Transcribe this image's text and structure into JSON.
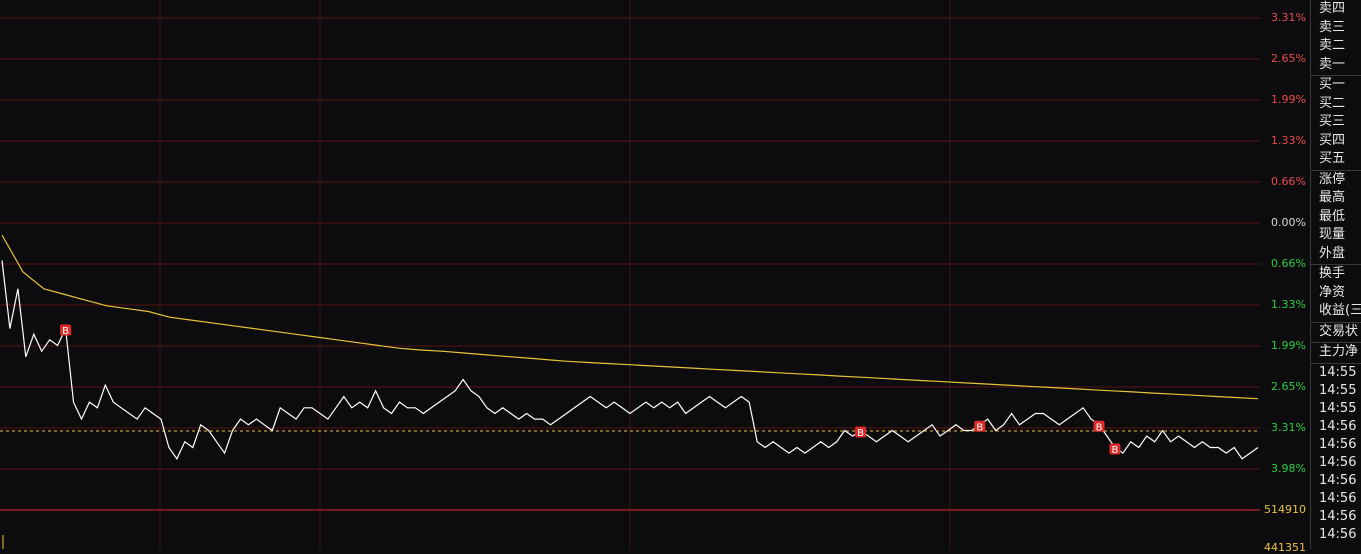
{
  "chart_data": {
    "type": "line",
    "pct_labels": [
      {
        "text": "3.31%",
        "color": "#e84a4a"
      },
      {
        "text": "2.65%",
        "color": "#e84a4a"
      },
      {
        "text": "1.99%",
        "color": "#e84a4a"
      },
      {
        "text": "1.33%",
        "color": "#e84a4a"
      },
      {
        "text": "0.66%",
        "color": "#e84a4a"
      },
      {
        "text": "0.00%",
        "color": "#d8d8d8"
      },
      {
        "text": "0.66%",
        "color": "#2ecc40"
      },
      {
        "text": "1.33%",
        "color": "#2ecc40"
      },
      {
        "text": "1.99%",
        "color": "#2ecc40"
      },
      {
        "text": "2.65%",
        "color": "#2ecc40"
      },
      {
        "text": "3.31%",
        "color": "#2ecc40"
      },
      {
        "text": "3.98%",
        "color": "#2ecc40"
      }
    ],
    "volume_labels": [
      "514910",
      "441351"
    ],
    "ylim": [
      -3.98,
      3.98
    ],
    "series": [
      {
        "color": "#ffffff",
        "values": [
          -0.3,
          -1.5,
          -0.8,
          -2.0,
          -1.6,
          -1.9,
          -1.7,
          -1.8,
          -1.5,
          -2.8,
          -3.1,
          -2.8,
          -2.9,
          -2.5,
          -2.8,
          -2.9,
          -3.0,
          -3.1,
          -2.9,
          -3.0,
          -3.1,
          -3.6,
          -3.8,
          -3.5,
          -3.6,
          -3.2,
          -3.3,
          -3.5,
          -3.7,
          -3.3,
          -3.1,
          -3.2,
          -3.1,
          -3.2,
          -3.3,
          -2.9,
          -3.0,
          -3.1,
          -2.9,
          -2.9,
          -3.0,
          -3.1,
          -2.9,
          -2.7,
          -2.9,
          -2.8,
          -2.9,
          -2.6,
          -2.9,
          -3.0,
          -2.8,
          -2.9,
          -2.9,
          -3.0,
          -2.9,
          -2.8,
          -2.7,
          -2.6,
          -2.4,
          -2.6,
          -2.7,
          -2.9,
          -3.0,
          -2.9,
          -3.0,
          -3.1,
          -3.0,
          -3.1,
          -3.1,
          -3.2,
          -3.1,
          -3.0,
          -2.9,
          -2.8,
          -2.7,
          -2.8,
          -2.9,
          -2.8,
          -2.9,
          -3.0,
          -2.9,
          -2.8,
          -2.9,
          -2.8,
          -2.9,
          -2.8,
          -3.0,
          -2.9,
          -2.8,
          -2.7,
          -2.8,
          -2.9,
          -2.8,
          -2.7,
          -2.8,
          -3.5,
          -3.6,
          -3.5,
          -3.6,
          -3.7,
          -3.6,
          -3.7,
          -3.6,
          -3.5,
          -3.6,
          -3.5,
          -3.3,
          -3.4,
          -3.3,
          -3.4,
          -3.5,
          -3.4,
          -3.3,
          -3.4,
          -3.5,
          -3.4,
          -3.3,
          -3.2,
          -3.4,
          -3.3,
          -3.2,
          -3.3,
          -3.3,
          -3.2,
          -3.1,
          -3.3,
          -3.2,
          -3.0,
          -3.2,
          -3.1,
          -3.0,
          -3.0,
          -3.1,
          -3.2,
          -3.1,
          -3.0,
          -2.9,
          -3.1,
          -3.2,
          -3.4,
          -3.6,
          -3.7,
          -3.5,
          -3.6,
          -3.4,
          -3.5,
          -3.3,
          -3.5,
          -3.4,
          -3.5,
          -3.6,
          -3.5,
          -3.6,
          -3.6,
          -3.7,
          -3.6,
          -3.8,
          -3.7,
          -3.6
        ],
        "markers": [
          {
            "index": 8,
            "label": "B",
            "color": "#e02a2a"
          },
          {
            "index": 108,
            "label": "B",
            "color": "#e02a2a"
          },
          {
            "index": 123,
            "label": "B",
            "color": "#e02a2a"
          },
          {
            "index": 138,
            "label": "B",
            "color": "#e02a2a"
          },
          {
            "index": 140,
            "label": "B",
            "color": "#e02a2a"
          }
        ]
      },
      {
        "color": "#e8c33a",
        "values": [
          0.15,
          -0.5,
          -0.8,
          -0.9,
          -1.0,
          -1.1,
          -1.15,
          -1.2,
          -1.3,
          -1.35,
          -1.4,
          -1.45,
          -1.5,
          -1.55,
          -1.6,
          -1.65,
          -1.7,
          -1.75,
          -1.8,
          -1.85,
          -1.88,
          -1.9,
          -1.93,
          -1.96,
          -1.99,
          -2.02,
          -2.05,
          -2.08,
          -2.1,
          -2.12,
          -2.14,
          -2.16,
          -2.18,
          -2.2,
          -2.22,
          -2.24,
          -2.26,
          -2.28,
          -2.3,
          -2.32,
          -2.34,
          -2.36,
          -2.38,
          -2.4,
          -2.42,
          -2.44,
          -2.46,
          -2.48,
          -2.5,
          -2.52,
          -2.54,
          -2.56,
          -2.58,
          -2.6,
          -2.62,
          -2.64,
          -2.66,
          -2.68,
          -2.7,
          -2.72,
          -2.74
        ]
      }
    ],
    "reference_pct": -3.31
  },
  "side_panel": {
    "groups": [
      [
        "卖四",
        "卖三",
        "卖二",
        "卖一"
      ],
      [
        "买一",
        "买二",
        "买三",
        "买四",
        "买五"
      ],
      [
        "涨停",
        "最高",
        "最低",
        "现量",
        "外盘"
      ],
      [
        "换手",
        "净资",
        "收益(三"
      ],
      [
        "交易状"
      ],
      [
        "主力净"
      ]
    ],
    "times": [
      "14:55",
      "14:55",
      "14:55",
      "14:56",
      "14:56",
      "14:56",
      "14:56",
      "14:56",
      "14:56",
      "14:56"
    ]
  }
}
